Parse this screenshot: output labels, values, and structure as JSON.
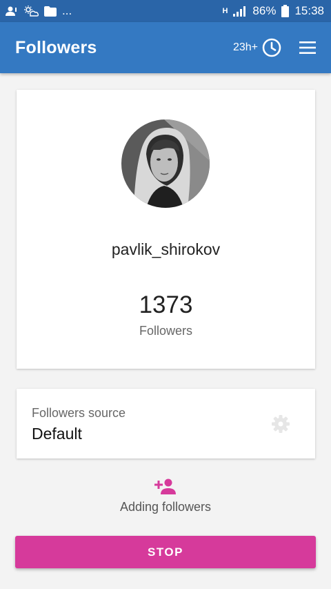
{
  "status_bar": {
    "left_ellipsis": "...",
    "network_type": "H",
    "battery": "86%",
    "time": "15:38",
    "icons": [
      "notification-person-icon",
      "weather-icon",
      "folder-icon",
      "signal-icon",
      "battery-icon"
    ]
  },
  "app_bar": {
    "title": "Followers",
    "timer_label": "23h+",
    "icons": [
      "clock-icon",
      "menu-icon"
    ],
    "color": "#3479c2"
  },
  "profile": {
    "username": "pavlik_shirokov",
    "followers_count": "1373",
    "followers_label": "Followers"
  },
  "source": {
    "label": "Followers source",
    "value": "Default",
    "icon": "gear-icon"
  },
  "status": {
    "label": "Adding followers",
    "icon": "add-person-icon",
    "icon_color": "#d63a9b"
  },
  "actions": {
    "stop_label": "STOP",
    "stop_color": "#d63a9b"
  }
}
